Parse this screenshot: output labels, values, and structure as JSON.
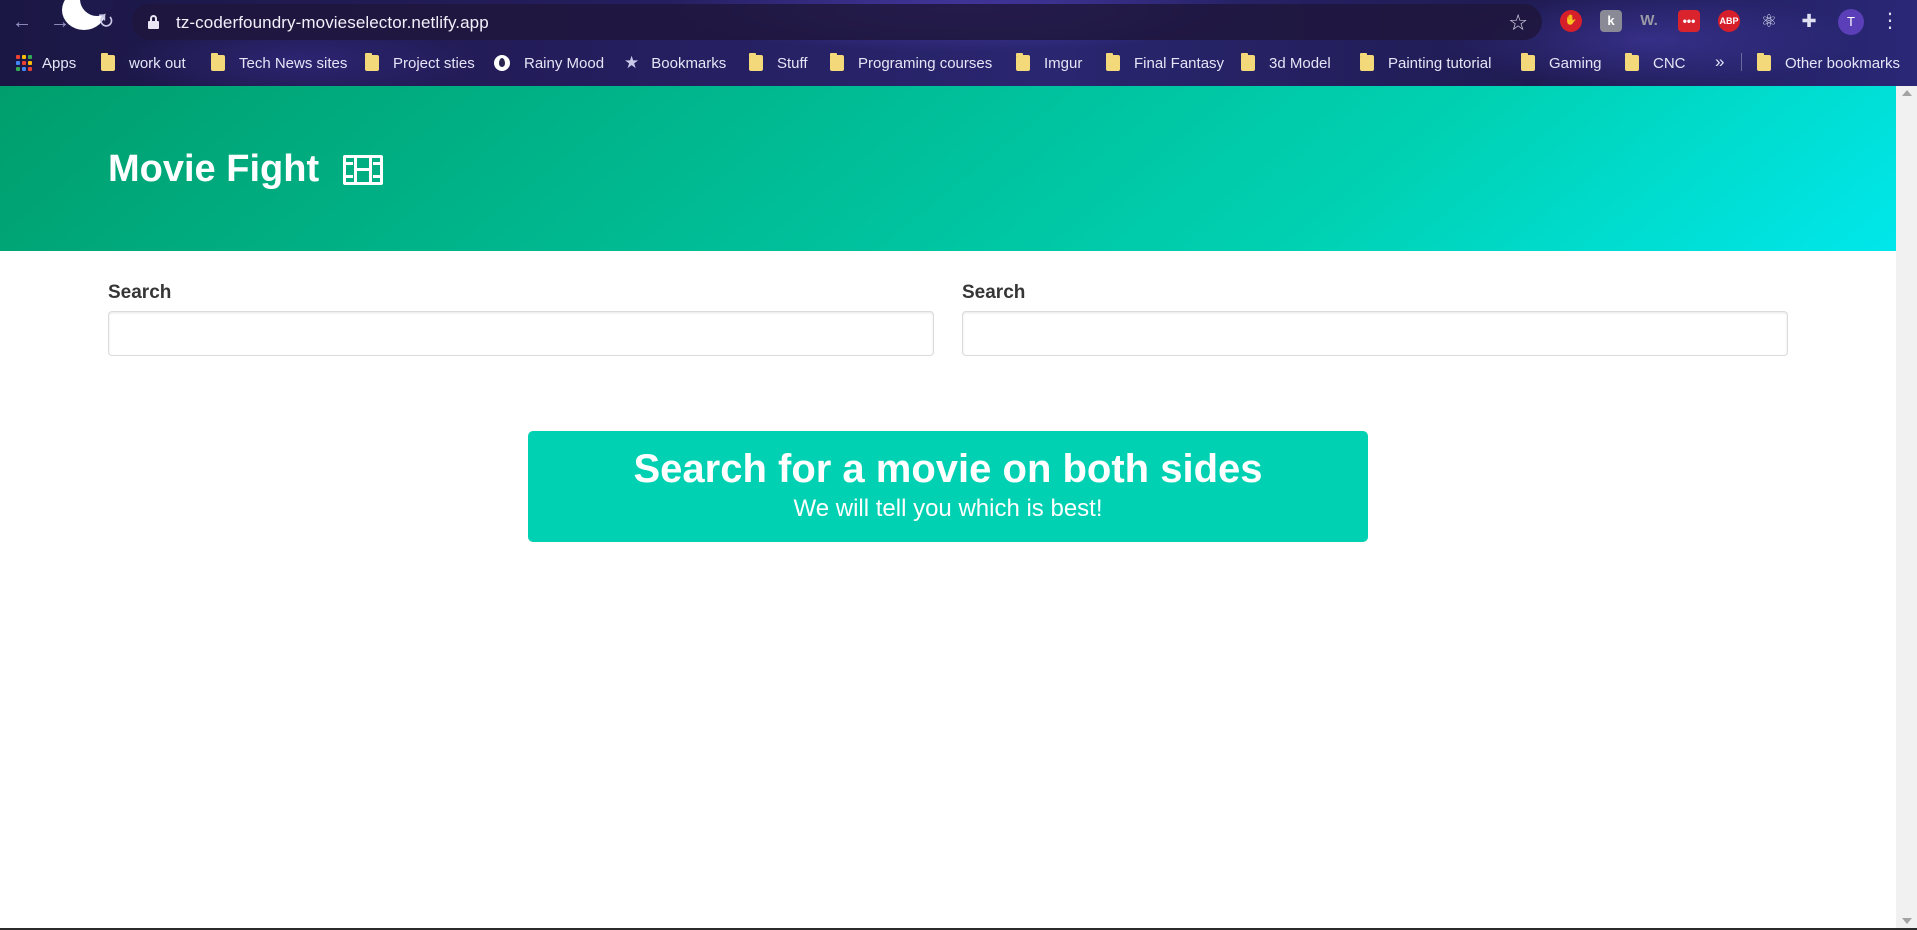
{
  "browser": {
    "url": "tz-coderfoundry-movieselector.netlify.app",
    "profile_initial": "T",
    "extensions": {
      "k_label": "k",
      "w_label": "W.",
      "dots_label": "•••",
      "abp_label": "ABP"
    },
    "bookmarks": [
      {
        "label": "Apps",
        "icon": "apps-grid-icon"
      },
      {
        "label": "work out",
        "icon": "folder-icon"
      },
      {
        "label": "Tech News sites",
        "icon": "folder-icon"
      },
      {
        "label": "Project sties",
        "icon": "folder-icon"
      },
      {
        "label": "Rainy Mood",
        "icon": "raindrop-icon"
      },
      {
        "label": "Bookmarks",
        "icon": "star-icon"
      },
      {
        "label": "Stuff",
        "icon": "folder-icon"
      },
      {
        "label": "Programing courses",
        "icon": "folder-icon"
      },
      {
        "label": "Imgur",
        "icon": "folder-icon"
      },
      {
        "label": "Final Fantasy",
        "icon": "folder-icon"
      },
      {
        "label": "3d Model",
        "icon": "folder-icon"
      },
      {
        "label": "Painting tutorial",
        "icon": "folder-icon"
      },
      {
        "label": "Gaming",
        "icon": "folder-icon"
      },
      {
        "label": "CNC",
        "icon": "folder-icon"
      }
    ],
    "overflow_label": "»",
    "other_bookmarks": "Other bookmarks"
  },
  "hero": {
    "title": "Movie Fight",
    "icon": "film-icon"
  },
  "search": {
    "left_label": "Search",
    "right_label": "Search",
    "left_value": "",
    "right_value": ""
  },
  "cta": {
    "title": "Search for a movie on both sides",
    "subtitle": "We will tell you which is best!"
  },
  "colors": {
    "primary": "#00d1b2",
    "hero_start": "#009e6c",
    "hero_end": "#00e7eb"
  }
}
